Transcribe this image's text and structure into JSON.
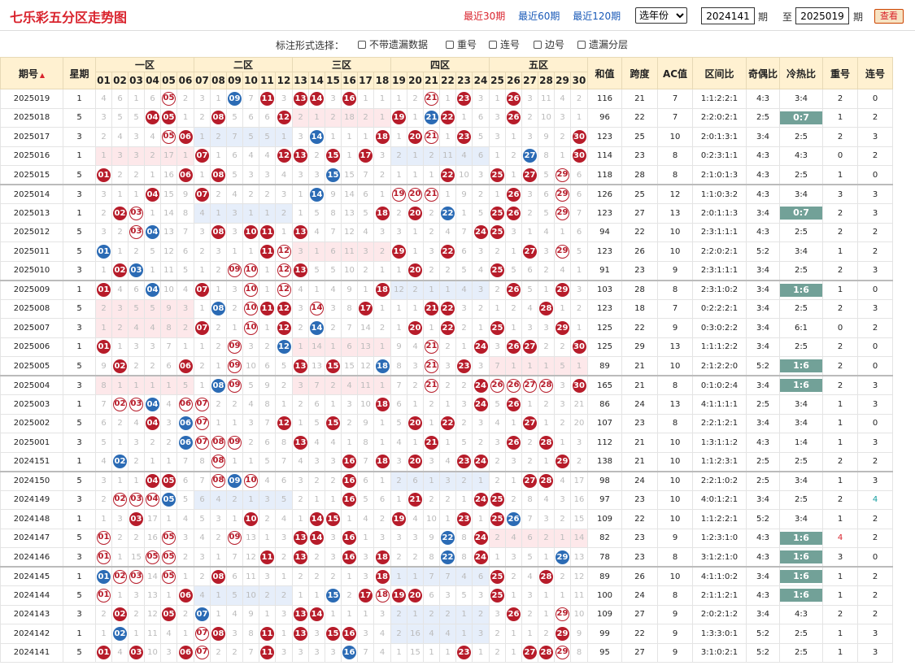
{
  "header": {
    "title": "七乐彩五分区走势图",
    "periods": [
      "最近30期",
      "最近60期",
      "最近120期"
    ],
    "active": 0,
    "year_select": "选年份",
    "from": "2024141",
    "to": "2025019",
    "qi": "期",
    "zhi": "至",
    "query": "查看"
  },
  "options": {
    "label": "标注形式选择：",
    "items": [
      "不带遗漏数据",
      "重号",
      "连号",
      "边号",
      "遗漏分层"
    ]
  },
  "cols": {
    "period": "期号",
    "week": "星期",
    "zones": [
      "一区",
      "二区",
      "三区",
      "四区",
      "五区"
    ],
    "stats": [
      "和值",
      "跨度",
      "AC值",
      "区间比",
      "奇偶比",
      "冷热比",
      "重号",
      "连号"
    ]
  },
  "colors": {
    "ball_red": "#b71c2a",
    "ball_blue": "#2b6bb5",
    "hot": "#72a198",
    "header": "#fff1d1"
  },
  "rows": [
    {
      "p": "2025019",
      "w": "1",
      "c": "R4,R6,R1,R6,O05,R2,R3,R1,B09,R7,N11,R3,N13,N14,R3,N16,R1,R1,R1,R2,O21,R1,N23,R3,R1,N26,R3,R11,R4,R2",
      "s": [
        "116",
        "21",
        "7",
        "1:1:2:2:1",
        "4:3",
        "3:4",
        "2",
        "0"
      ]
    },
    {
      "p": "2025018",
      "w": "5",
      "c": "R3,R5,R5,N04,N05,R1,R2,N08,R5,R6,R6,N12,R2,R1,R2,R18,R2,R1,N19,R1,B21,N22,R1,R6,R3,N26,R2,R10,R3,R1",
      "s": [
        "96",
        "22",
        "7",
        "2:2:0:2:1",
        "2:5",
        "H0:7",
        "1",
        "2"
      ]
    },
    {
      "p": "2025017",
      "w": "3",
      "c": "R2,R4,R3,R4,O05,N06,R1,R2,R7,R5,R5,R1,R3,B14,R1,R1,R1,N18,R1,N20,O21,R1,N23,R5,R3,R1,R3,R9,R2,N30",
      "s": [
        "123",
        "25",
        "10",
        "2:0:1:3:1",
        "3:4",
        "2:5",
        "2",
        "3"
      ]
    },
    {
      "p": "2025016",
      "w": "1",
      "c": "R1,R3,R3,R2,R17,R1,N07,R1,R6,R4,R4,N12,N13,R2,N15,R1,N17,R3,R2,R1,R2,R11,R4,R6,R1,R2,B27,R8,R1,N30",
      "s": [
        "114",
        "23",
        "8",
        "0:2:3:1:1",
        "4:3",
        "4:3",
        "0",
        "2"
      ]
    },
    {
      "p": "2025015",
      "w": "5",
      "c": "N01,R2,R2,R1,R16,N06,R1,N08,R5,R3,R3,R4,R3,R3,B15,R15,R7,R2,R1,R1,R1,N22,R10,R3,N25,R1,N27,R5,O29,R6",
      "s": [
        "118",
        "28",
        "8",
        "2:1:0:1:3",
        "4:3",
        "2:5",
        "1",
        "0"
      ]
    },
    {
      "p": "2025014",
      "w": "3",
      "c": "R3,R1,R1,N04,R15,R9,N07,R2,R4,R2,R2,R3,R1,B14,R9,R14,R6,R1,O19,O20,O21,R1,R9,R2,R1,N26,R3,R6,O29,R6",
      "s": [
        "126",
        "25",
        "12",
        "1:1:0:3:2",
        "4:3",
        "3:4",
        "3",
        "3"
      ]
    },
    {
      "p": "2025013",
      "w": "1",
      "c": "R2,N02,O03,R1,R14,R8,R4,R1,R3,R1,R1,R2,R1,R5,R8,R13,R5,N18,R2,N20,R2,B22,R1,R5,N25,N26,R2,R5,O29,R7",
      "s": [
        "123",
        "27",
        "13",
        "2:0:1:1:3",
        "3:4",
        "H0:7",
        "2",
        "3"
      ]
    },
    {
      "p": "2025012",
      "w": "5",
      "c": "R3,R2,O03,B04,R13,R7,R3,N08,R3,N10,N11,R1,N13,R4,R7,R12,R4,R3,R3,R1,R2,R4,R7,N24,N25,R3,R1,R4,R1,R6",
      "s": [
        "94",
        "22",
        "10",
        "2:3:1:1:1",
        "4:3",
        "2:5",
        "2",
        "2"
      ]
    },
    {
      "p": "2025011",
      "w": "5",
      "c": "B01,R1,R2,R5,R12,R6,R2,R3,R1,R1,N11,O12,R3,R1,R6,R11,R3,R2,N19,R1,R3,N22,R6,R3,R2,R1,N27,R3,O29,R5",
      "s": [
        "123",
        "26",
        "10",
        "2:2:0:2:1",
        "5:2",
        "3:4",
        "1",
        "2"
      ]
    },
    {
      "p": "2025010",
      "w": "3",
      "c": "R1,N02,B03,R1,R11,R5,R1,R2,O09,O10,R1,O12,N13,R5,R5,R10,R2,R1,R1,N20,R2,R2,R5,R4,N25,R5,R6,R2,R4,R1",
      "s": [
        "91",
        "23",
        "9",
        "2:3:1:1:1",
        "3:4",
        "2:5",
        "2",
        "3"
      ]
    },
    {
      "p": "2025009",
      "w": "1",
      "c": "N01,R4,R6,B04,R10,R4,N07,R1,R3,O10,R1,O12,R4,R1,R4,R9,R1,N18,R12,R2,R1,R1,R4,R3,R2,N26,R5,R1,N29,R3",
      "s": [
        "103",
        "28",
        "8",
        "2:3:1:0:2",
        "3:4",
        "H1:6",
        "1",
        "0"
      ]
    },
    {
      "p": "2025008",
      "w": "5",
      "c": "R2,R3,R5,R5,R9,R3,R1,B08,R2,O10,N11,N12,R3,O14,R3,R8,N17,R1,R1,R1,N21,N22,R3,R2,R1,R2,R4,N28,R1,R2",
      "s": [
        "123",
        "18",
        "7",
        "0:2:2:2:1",
        "3:4",
        "2:5",
        "2",
        "3"
      ]
    },
    {
      "p": "2025007",
      "w": "3",
      "c": "R1,R2,R4,R4,R8,R2,N07,R2,R1,O10,R1,N12,R2,B14,R2,R7,R14,R2,R1,N20,R1,N22,R2,R1,N25,R1,R3,R3,N29,R1",
      "s": [
        "125",
        "22",
        "9",
        "0:3:0:2:2",
        "3:4",
        "6:1",
        "0",
        "2"
      ]
    },
    {
      "p": "2025006",
      "w": "1",
      "c": "N01,R1,R3,R3,R7,R1,R1,R2,O09,R3,R2,B12,R1,R14,R1,R6,R13,R1,R9,R4,O21,R2,R1,N24,R3,N26,N27,R2,R2,N30",
      "s": [
        "125",
        "29",
        "13",
        "1:1:1:2:2",
        "3:4",
        "2:5",
        "2",
        "0"
      ]
    },
    {
      "p": "2025005",
      "w": "5",
      "c": "R9,N02,R2,R2,R6,N06,R2,R1,O09,R10,R6,R5,N13,R13,N15,R15,R12,B18,R8,R3,O21,R3,N23,R3,R7,R1,R1,R1,R5,R1",
      "s": [
        "89",
        "21",
        "10",
        "2:1:2:2:0",
        "5:2",
        "H1:6",
        "2",
        "0"
      ]
    },
    {
      "p": "2025004",
      "w": "3",
      "c": "R8,R1,R1,R1,R1,R5,R1,B08,O09,R5,R9,R2,R3,R7,R2,R4,R11,R1,R7,R2,O21,R2,R2,N24,O26,O26,O27,O28,R3,N30",
      "s": [
        "165",
        "21",
        "8",
        "0:1:0:2:4",
        "3:4",
        "H1:6",
        "2",
        "3"
      ]
    },
    {
      "p": "2025003",
      "w": "1",
      "c": "R7,O02,O03,B04,R4,O06,O07,R2,R2,R4,R8,R1,R2,R6,R1,R3,R10,N18,R6,R1,R2,R1,R3,N24,R5,N26,R1,R2,R3,R21",
      "s": [
        "86",
        "24",
        "13",
        "4:1:1:1:1",
        "2:5",
        "3:4",
        "1",
        "3"
      ]
    },
    {
      "p": "2025002",
      "w": "5",
      "c": "R6,R2,R4,N04,R3,B06,O07,R1,R1,R3,R7,N12,R1,R5,N15,R2,R9,R1,R5,N20,R1,N22,R2,R3,R4,R1,N27,R1,R2,R20",
      "s": [
        "107",
        "23",
        "8",
        "2:2:1:2:1",
        "3:4",
        "3:4",
        "1",
        "0"
      ]
    },
    {
      "p": "2025001",
      "w": "3",
      "c": "R5,R1,R3,R2,R2,B06,O07,O08,O09,R2,R6,R8,N13,R4,R4,R1,R8,R1,R4,R1,N21,R1,R5,R2,R3,N26,R2,N28,R1,R3",
      "s": [
        "112",
        "21",
        "10",
        "1:3:1:1:2",
        "4:3",
        "1:4",
        "1",
        "3"
      ]
    },
    {
      "p": "2024151",
      "w": "1",
      "c": "R4,B02,R2,R1,R1,R7,R8,O08,R1,R1,R5,R7,R4,R3,R3,N16,R7,N18,R3,N20,R3,R4,N23,N24,R2,R3,R2,R1,N29,R2",
      "s": [
        "138",
        "21",
        "10",
        "1:1:2:3:1",
        "2:5",
        "2:5",
        "2",
        "2"
      ]
    },
    {
      "p": "2024150",
      "w": "5",
      "c": "R3,R1,R1,N04,N05,R6,R7,O08,B09,O10,R4,R6,R3,R2,R2,N16,R6,R1,R2,R6,R1,R3,R2,R1,R2,R1,N27,N28,R4,R17",
      "s": [
        "98",
        "24",
        "10",
        "2:2:1:0:2",
        "2:5",
        "3:4",
        "1",
        "3"
      ]
    },
    {
      "p": "2024149",
      "w": "3",
      "c": "R2,O02,O03,O04,B05,R5,R6,R4,R2,R1,R3,R5,R2,R1,R1,N16,R5,R6,R1,N21,R2,R2,R1,N24,N25,R2,R8,R4,R3,R16",
      "s": [
        "97",
        "23",
        "10",
        "4:0:1:2:1",
        "3:4",
        "2:5",
        "2",
        "T4"
      ]
    },
    {
      "p": "2024148",
      "w": "1",
      "c": "R1,R3,N03,R17,R1,R4,R5,R3,R1,N10,R2,R4,R1,N14,N15,R1,R4,R2,N19,R4,R10,R1,N23,R1,N25,B26,R7,R3,R2,R15",
      "s": [
        "109",
        "22",
        "10",
        "1:1:2:2:1",
        "5:2",
        "3:4",
        "1",
        "2"
      ]
    },
    {
      "p": "2024147",
      "w": "5",
      "c": "O01,R2,R2,R16,O05,R3,R4,R2,O09,R13,R1,R3,N13,N14,R3,N16,R1,R3,R3,R3,R9,B22,R8,N24,R2,R4,R6,R2,R1,R14",
      "s": [
        "82",
        "23",
        "9",
        "1:2:3:1:0",
        "4:3",
        "H1:6",
        "L4",
        "2"
      ]
    },
    {
      "p": "2024146",
      "w": "3",
      "c": "O01,R1,R15,O05,O05,R2,R3,R1,R7,R12,N11,R2,N13,R2,R3,N16,R3,N18,R2,R2,R8,B22,R8,N24,R1,R3,R5,R1,B29,R13",
      "s": [
        "78",
        "23",
        "8",
        "3:1:2:1:0",
        "4:3",
        "H1:6",
        "3",
        "0"
      ]
    },
    {
      "p": "2024145",
      "w": "1",
      "c": "B01,O02,O03,R14,O05,R1,R2,N08,R6,R11,R3,R1,R2,R2,R2,R1,R3,N18,R1,R1,R7,R7,R4,R6,N25,R2,R4,N28,R2,R12",
      "s": [
        "89",
        "26",
        "10",
        "4:1:1:0:2",
        "3:4",
        "H1:6",
        "1",
        "2"
      ]
    },
    {
      "p": "2024144",
      "w": "5",
      "c": "O01,R1,R3,R13,R1,N06,R4,R1,R5,R10,R2,R2,R1,R1,B15,R2,N17,O18,N19,N20,R6,R3,R5,R3,N25,R1,R3,R1,R1,R11",
      "s": [
        "100",
        "24",
        "8",
        "2:1:1:2:1",
        "4:3",
        "H1:6",
        "1",
        "2"
      ]
    },
    {
      "p": "2024143",
      "w": "3",
      "c": "R2,N02,R2,R12,N05,R2,B07,R1,R4,R9,R1,R3,N13,N14,R1,R1,R1,R3,R2,R1,R2,R2,R1,R2,R3,N26,R2,R1,O29,R10",
      "s": [
        "109",
        "27",
        "9",
        "2:0:2:1:2",
        "3:4",
        "4:3",
        "2",
        "2"
      ]
    },
    {
      "p": "2024142",
      "w": "1",
      "c": "R1,B02,R1,R11,R4,R1,O07,N08,R3,R8,N11,R1,N13,R3,N15,N16,R3,R4,R2,R16,R4,R4,R1,R3,R2,R1,R1,R2,N29,R9",
      "s": [
        "99",
        "22",
        "9",
        "1:3:3:0:1",
        "5:2",
        "2:5",
        "1",
        "3"
      ]
    },
    {
      "p": "2024141",
      "w": "5",
      "c": "N01,R4,N03,R10,R3,N06,O07,R2,R2,R7,N11,R3,R3,R3,R3,B16,R7,R4,R1,R15,R1,R1,N23,R1,R2,R1,N27,N28,O29,R8",
      "s": [
        "95",
        "27",
        "9",
        "3:1:0:2:1",
        "5:2",
        "2:5",
        "1",
        "3"
      ]
    }
  ]
}
